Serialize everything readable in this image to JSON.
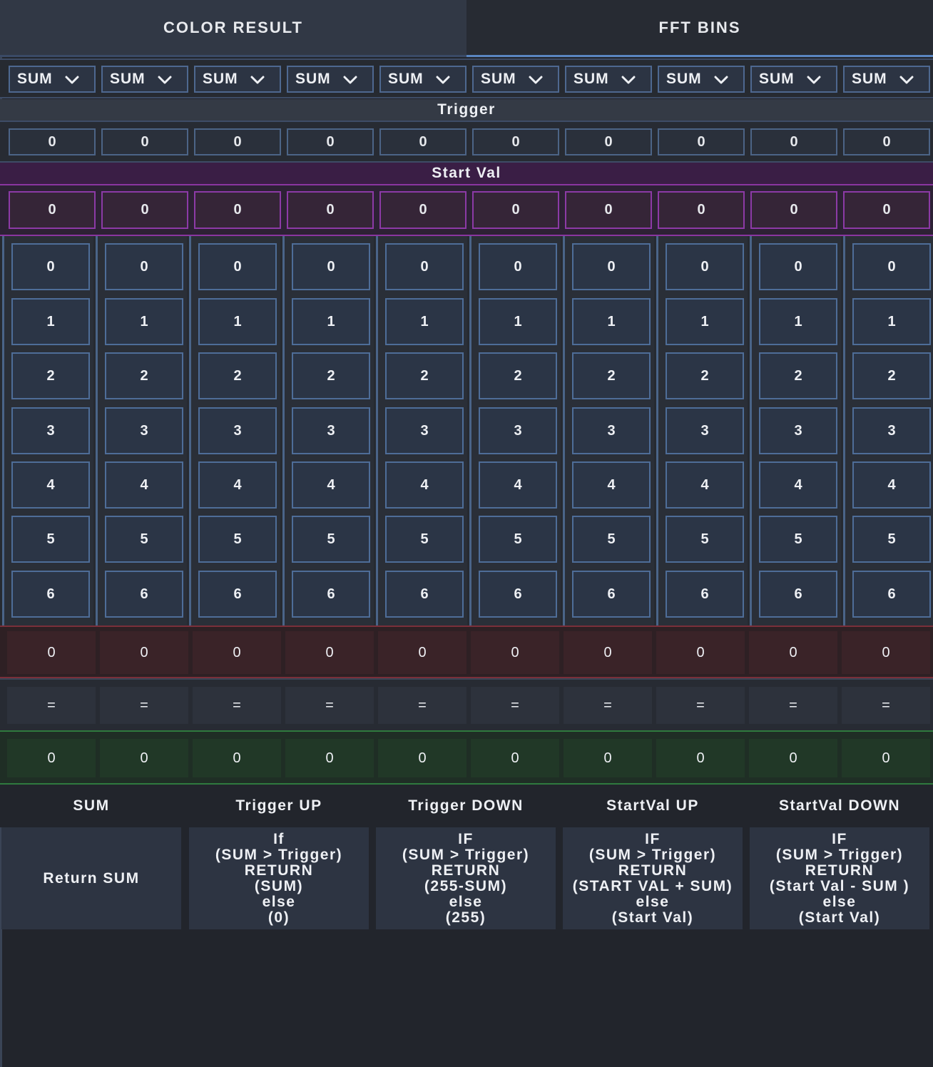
{
  "tabs": [
    "COLOR RESULT",
    "FFT BINS"
  ],
  "dropdowns": [
    "SUM",
    "SUM",
    "SUM",
    "SUM",
    "SUM",
    "SUM",
    "SUM",
    "SUM",
    "SUM",
    "SUM"
  ],
  "dropdown_icon": "chevron-down-icon",
  "trigger_header": "Trigger",
  "trigger_values": [
    "0",
    "0",
    "0",
    "0",
    "0",
    "0",
    "0",
    "0",
    "0",
    "0"
  ],
  "startval_header": "Start Val",
  "startval_values": [
    "0",
    "0",
    "0",
    "0",
    "0",
    "0",
    "0",
    "0",
    "0",
    "0"
  ],
  "bins": [
    "0",
    "1",
    "2",
    "3",
    "4",
    "5",
    "6"
  ],
  "sum_values": [
    "0",
    "0",
    "0",
    "0",
    "0",
    "0",
    "0",
    "0",
    "0",
    "0"
  ],
  "equals": [
    "=",
    "=",
    "=",
    "=",
    "=",
    "=",
    "=",
    "=",
    "=",
    "="
  ],
  "result_values": [
    "0",
    "0",
    "0",
    "0",
    "0",
    "0",
    "0",
    "0",
    "0",
    "0"
  ],
  "modes": [
    "SUM",
    "Trigger UP",
    "Trigger DOWN",
    "StartVal UP",
    "StartVal DOWN"
  ],
  "descriptions": [
    [
      "Return SUM"
    ],
    [
      "If",
      "(SUM > Trigger)",
      "RETURN",
      "(SUM)",
      "else",
      "(0)"
    ],
    [
      "IF",
      "(SUM > Trigger)",
      "RETURN",
      "(255-SUM)",
      "else",
      "(255)"
    ],
    [
      "IF",
      "(SUM > Trigger)",
      "RETURN",
      "(START VAL + SUM)",
      "else",
      "(Start Val)"
    ],
    [
      "IF",
      "(SUM > Trigger)",
      "RETURN",
      "(Start Val - SUM )",
      "else",
      "(Start Val)"
    ]
  ],
  "colors": {
    "tab_active_underline": "#5a86c2",
    "start_val_accent": "#8a35a0",
    "sum_accent": "#7a2f3a",
    "result_accent": "#2f7a3e",
    "bin_border": "#4e6d98"
  }
}
